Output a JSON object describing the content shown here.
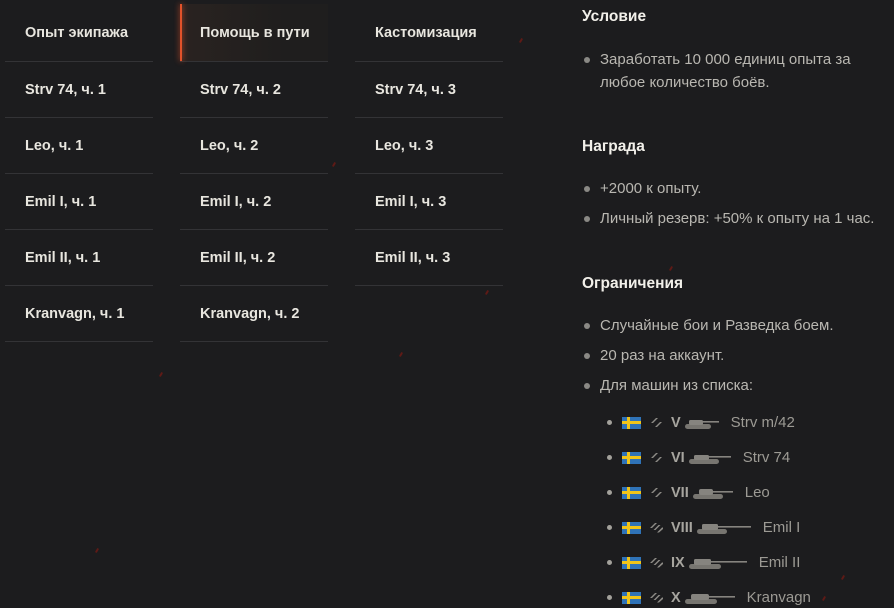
{
  "tabs": {
    "columns": [
      {
        "header": "Опыт экипажа",
        "items": [
          "Strv 74, ч. 1",
          "Leo, ч. 1",
          "Emil I, ч. 1",
          "Emil II, ч. 1",
          "Kranvagn, ч. 1"
        ]
      },
      {
        "header": "Помощь в пути",
        "active": true,
        "items": [
          "Strv 74, ч. 2",
          "Leo, ч. 2",
          "Emil I, ч. 2",
          "Emil II, ч. 2",
          "Kranvagn, ч. 2"
        ]
      },
      {
        "header": "Кастомизация",
        "items": [
          "Strv 74, ч. 3",
          "Leo, ч. 3",
          "Emil I, ч. 3",
          "Emil II, ч. 3"
        ]
      }
    ]
  },
  "details": {
    "condition": {
      "title": "Условие",
      "items": [
        "Заработать 10 000 единиц опыта за",
        "любое количество боёв."
      ]
    },
    "reward": {
      "title": "Награда",
      "items": [
        "+2000 к опыту.",
        "Личный резерв: +50% к опыту на 1 час."
      ]
    },
    "limits": {
      "title": "Ограничения",
      "items": [
        "Случайные бои и Разведка боем.",
        "20 раз на аккаунт.",
        "Для машин из списка:"
      ]
    },
    "tanks": [
      {
        "tier": "V",
        "name": "Strv m/42",
        "class": "medium-tank-icon",
        "flag": "sweden-flag-icon"
      },
      {
        "tier": "VI",
        "name": "Strv 74",
        "class": "medium-tank-icon",
        "flag": "sweden-flag-icon"
      },
      {
        "tier": "VII",
        "name": "Leo",
        "class": "medium-tank-icon",
        "flag": "sweden-flag-icon"
      },
      {
        "tier": "VIII",
        "name": "Emil I",
        "class": "heavy-tank-icon",
        "flag": "sweden-flag-icon"
      },
      {
        "tier": "IX",
        "name": "Emil II",
        "class": "heavy-tank-icon",
        "flag": "sweden-flag-icon"
      },
      {
        "tier": "X",
        "name": "Kranvagn",
        "class": "heavy-tank-icon",
        "flag": "sweden-flag-icon"
      }
    ]
  },
  "colors": {
    "background": "#1c1c1e",
    "accent": "#e2522a",
    "flag_blue": "#2f73b8",
    "flag_yellow": "#f0c419"
  }
}
